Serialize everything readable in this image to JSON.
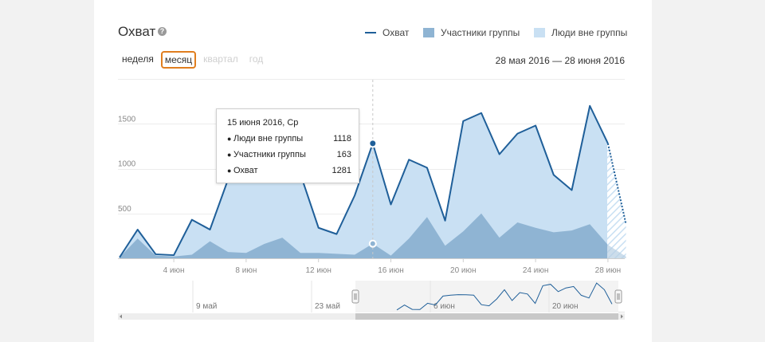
{
  "title": "Охват",
  "help_icon": "question-icon",
  "legend": [
    {
      "label": "Охват",
      "kind": "line",
      "color": "#1f5f99"
    },
    {
      "label": "Участники группы",
      "kind": "area",
      "color": "#8fb4d3"
    },
    {
      "label": "Люди вне группы",
      "kind": "area",
      "color": "#c9e0f3"
    }
  ],
  "periods": [
    {
      "label": "неделя",
      "state": "normal"
    },
    {
      "label": "месяц",
      "state": "active"
    },
    {
      "label": "квартал",
      "state": "disabled"
    },
    {
      "label": "год",
      "state": "disabled"
    }
  ],
  "date_range": "28 мая 2016 — 28 июня 2016",
  "tooltip": {
    "title": "15 июня 2016, Ср",
    "rows": [
      {
        "name": "Люди вне группы",
        "value": "1118"
      },
      {
        "name": "Участники группы",
        "value": "163"
      },
      {
        "name": "Охват",
        "value": "1281"
      }
    ]
  },
  "navigator": {
    "labels": [
      "9 май",
      "23 май",
      "6 июн",
      "20 июн"
    ]
  },
  "chart_data": {
    "type": "area",
    "x": [
      1,
      2,
      3,
      4,
      5,
      6,
      7,
      8,
      9,
      10,
      11,
      12,
      13,
      14,
      15,
      16,
      17,
      18,
      19,
      20,
      21,
      22,
      23,
      24,
      25,
      26,
      27,
      28,
      29
    ],
    "x_ticks": [
      {
        "day": 4,
        "label": "4 июн"
      },
      {
        "day": 8,
        "label": "8 июн"
      },
      {
        "day": 12,
        "label": "12 июн"
      },
      {
        "day": 16,
        "label": "16 июн"
      },
      {
        "day": 20,
        "label": "20 июн"
      },
      {
        "day": 24,
        "label": "24 июн"
      },
      {
        "day": 28,
        "label": "28 июн"
      }
    ],
    "y_ticks": [
      500,
      1000,
      1500
    ],
    "ylim": [
      0,
      2000
    ],
    "grid": true,
    "highlight_day": 15,
    "series": [
      {
        "name": "Охват",
        "values": [
          10,
          320,
          45,
          35,
          430,
          320,
          880,
          940,
          970,
          960,
          940,
          340,
          270,
          700,
          1281,
          600,
          1100,
          1010,
          420,
          1530,
          1620,
          1160,
          1390,
          1480,
          930,
          760,
          1700,
          1280,
          380
        ]
      },
      {
        "name": "Участники группы",
        "values": [
          10,
          220,
          30,
          20,
          40,
          190,
          70,
          60,
          160,
          230,
          60,
          60,
          50,
          40,
          163,
          30,
          220,
          460,
          140,
          300,
          500,
          230,
          400,
          340,
          290,
          310,
          380,
          150,
          20
        ]
      }
    ]
  }
}
